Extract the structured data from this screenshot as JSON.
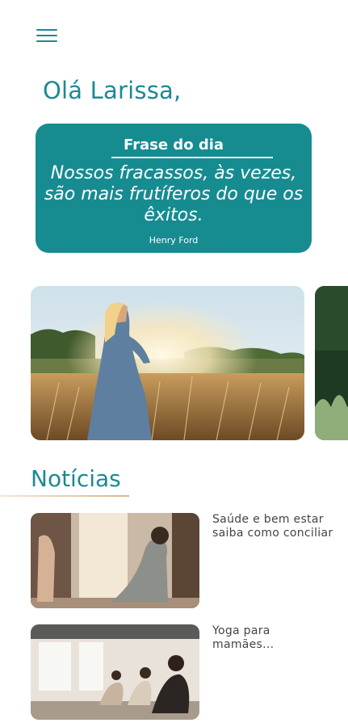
{
  "greeting": "Olá Larissa,",
  "quote": {
    "title": "Frase do dia",
    "text": "Nossos fracassos, às vezes, são mais frutíferos do que os êxitos.",
    "author": "Henry Ford"
  },
  "news": {
    "title": "Notícias",
    "items": [
      {
        "title": "Saúde e bem estar saiba como conciliar"
      },
      {
        "title": "Yoga para mamães..."
      }
    ]
  },
  "colors": {
    "accent": "#1b8a93",
    "card": "#168c91"
  }
}
